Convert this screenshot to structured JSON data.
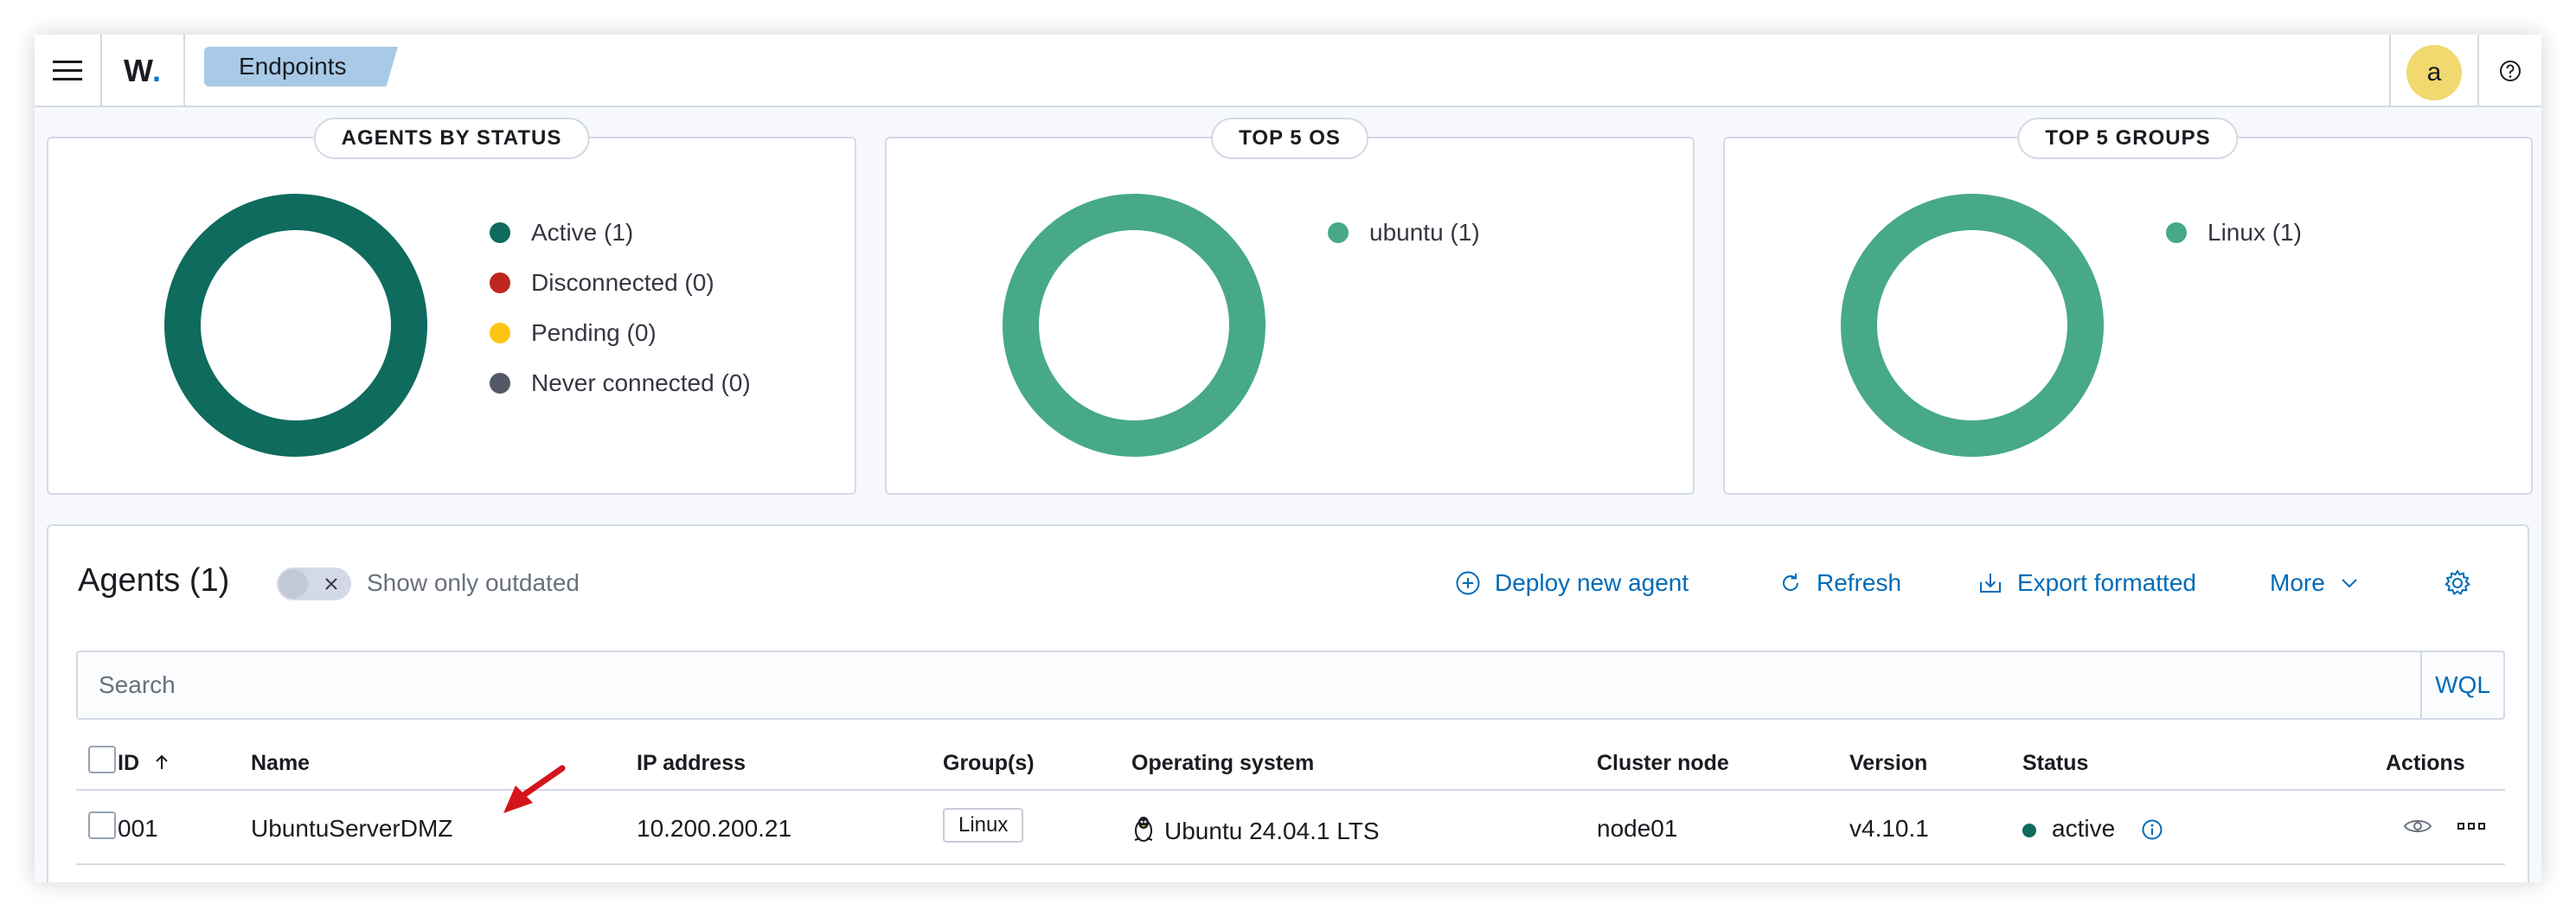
{
  "header": {
    "menu_icon": "hamburger-menu-icon",
    "logo_text": "W",
    "logo_dot": ".",
    "breadcrumb": "Endpoints",
    "avatar_letter": "a",
    "help_icon": "question-circle-icon"
  },
  "panels": [
    {
      "title": "AGENTS BY STATUS",
      "legend": [
        {
          "label": "Active (1)",
          "color": "#0e6b5e"
        },
        {
          "label": "Disconnected (0)",
          "color": "#bd271e"
        },
        {
          "label": "Pending (0)",
          "color": "#fec514"
        },
        {
          "label": "Never connected (0)",
          "color": "#535966"
        }
      ],
      "donut_color": "#0e6b5e"
    },
    {
      "title": "TOP 5 OS",
      "legend": [
        {
          "label": "ubuntu (1)",
          "color": "#47a987"
        }
      ],
      "donut_color": "#47a987"
    },
    {
      "title": "TOP 5 GROUPS",
      "legend": [
        {
          "label": "Linux (1)",
          "color": "#47a987"
        }
      ],
      "donut_color": "#47a987"
    }
  ],
  "agents": {
    "title": "Agents (1)",
    "toggle_label": "Show only outdated",
    "actions": {
      "deploy": "Deploy new agent",
      "refresh": "Refresh",
      "export": "Export formatted",
      "more": "More"
    },
    "search_placeholder": "Search",
    "wql": "WQL",
    "columns": [
      "ID",
      "Name",
      "IP address",
      "Group(s)",
      "Operating system",
      "Cluster node",
      "Version",
      "Status",
      "Actions"
    ],
    "sort_icon": "arrow-up-icon",
    "rows": [
      {
        "id": "001",
        "name": "UbuntuServerDMZ",
        "ip": "10.200.200.21",
        "group": "Linux",
        "os": "Ubuntu 24.04.1 LTS",
        "os_icon": "linux-penguin-icon",
        "cluster_node": "node01",
        "version": "v4.10.1",
        "status": "active"
      }
    ]
  },
  "annotation": {
    "icon": "red-arrow-annotation-icon",
    "color": "#d4141b"
  }
}
